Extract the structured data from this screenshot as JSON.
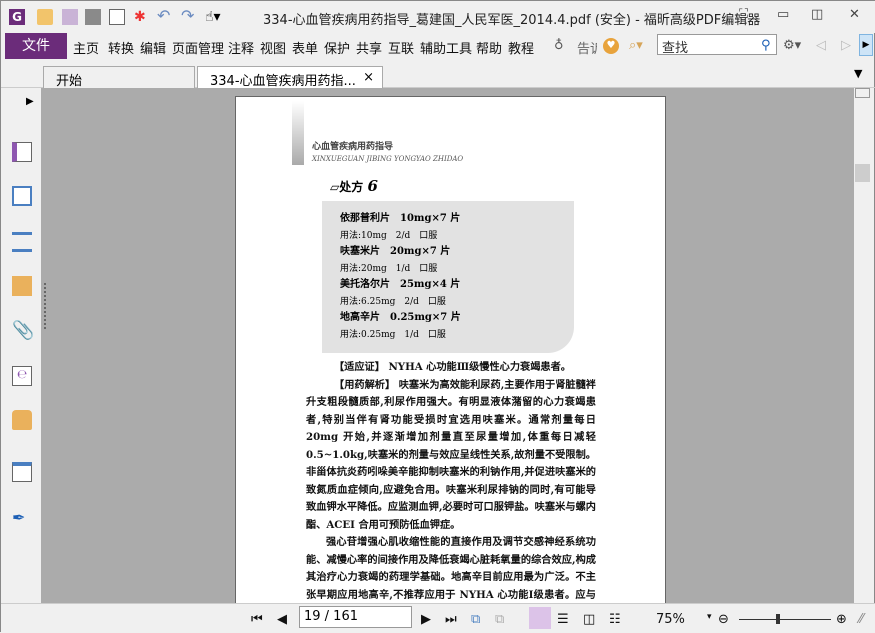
{
  "window": {
    "title": "334-心血管疾病用药指导_葛建国_人民军医_2014.4.pdf (安全) - 福昕高级PDF编辑器"
  },
  "menu": {
    "file": "文件",
    "items": [
      "主页",
      "转换",
      "编辑",
      "页面管理",
      "注释",
      "视图",
      "表单",
      "保护",
      "共享",
      "互联",
      "辅助工具",
      "帮助",
      "教程"
    ],
    "tell": "告诉",
    "search_placeholder": "查找"
  },
  "tabs": [
    {
      "label": "开始"
    },
    {
      "label": "334-心血管疾病用药指...",
      "close": "×"
    }
  ],
  "page": {
    "header_cn": "心血管疾病用药指导",
    "header_en": "XINXUEGUAN JIBING YONGYAO ZHIDAO",
    "prescription_title": "处方",
    "prescription_num": "6",
    "prescription_lines": [
      {
        "text": "依那普利片　10mg×7 片",
        "strong": true
      },
      {
        "text": "用法:10mg　2/d　口服",
        "strong": false
      },
      {
        "text": "呋塞米片　20mg×7 片",
        "strong": true
      },
      {
        "text": "用法:20mg　1/d　口服",
        "strong": false
      },
      {
        "text": "美托洛尔片　25mg×4 片",
        "strong": true
      },
      {
        "text": "用法:6.25mg　2/d　口服",
        "strong": false
      },
      {
        "text": "地高辛片　0.25mg×7 片",
        "strong": true
      },
      {
        "text": "用法:0.25mg　1/d　口服",
        "strong": false
      }
    ],
    "paragraphs": [
      "【适应证】 NYHA 心功能Ⅲ级慢性心力衰竭患者。",
      "【用药解析】 呋塞米为高效能利尿药,主要作用于肾脏髓袢升支粗段髓质部,利尿作用强大。有明显液体潴留的心力衰竭患者,特别当伴有肾功能受损时宜选用呋塞米。通常剂量每日 20mg 开始,并逐渐增加剂量直至尿量增加,体重每日减轻 0.5~1.0kg,呋塞米的剂量与效应呈线性关系,故剂量不受限制。非甾体抗炎药吲哚美辛能抑制呋塞米的利钠作用,并促进呋塞米的致氮质血症倾向,应避免合用。呋塞米利尿排钠的同时,有可能导致血钾水平降低。应监测血钾,必要时可口服钾盐。呋塞米与螺内酯、ACEI 合用可预防低血钾症。",
      "强心苷增强心肌收缩性能的直接作用及调节交感神经系统功能、减慢心率的间接作用及降低衰竭心脏耗氧量的综合效应,构成其治疗心力衰竭的药理学基础。地高辛目前应用最为广泛。不主张早期应用地高辛,不推荐应用于 NYHA 心功能Ⅰ级患者。应与利尿药、ACEI、β 受体阻滞药联合应用。不能"
    ]
  },
  "status": {
    "page_value": "19 / 161",
    "zoom": "75%",
    "zoom_fraction": 0.42
  },
  "colors": {
    "accent": "#6b2c7a"
  }
}
